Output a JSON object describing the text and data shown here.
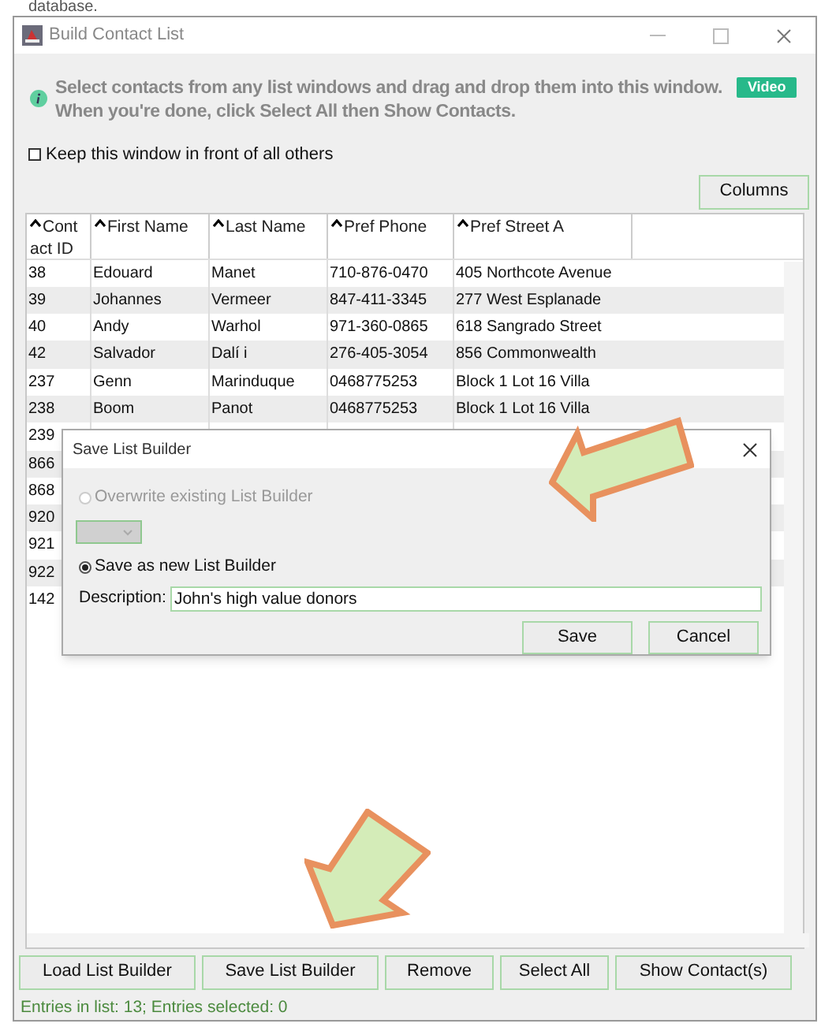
{
  "page_text": "database.",
  "window": {
    "title": "Build Contact List"
  },
  "info": {
    "lines": [
      "Select contacts from any list windows and drag and drop them into this window.",
      "When you're done, click Select All then Show Contacts."
    ],
    "video_button": "Video"
  },
  "keep_in_front": {
    "label": "Keep this window in front of all others",
    "checked": false
  },
  "columns_button": "Columns",
  "table": {
    "columns": [
      "Contact ID",
      "First Name",
      "Last Name",
      "Pref Phone",
      "Pref Street A"
    ],
    "rows": [
      [
        "38",
        "Edouard",
        "Manet",
        "710-876-0470",
        "405 Northcote Avenue"
      ],
      [
        "39",
        "Johannes",
        "Vermeer",
        "847-411-3345",
        "277 West Esplanade"
      ],
      [
        "40",
        "Andy",
        "Warhol",
        "971-360-0865",
        "618 Sangrado Street"
      ],
      [
        "42",
        "Salvador",
        "Dalí i",
        "276-405-3054",
        "856 Commonwealth"
      ],
      [
        "237",
        "Genn",
        "Marinduque",
        "0468775253",
        "Block 1 Lot 16 Villa"
      ],
      [
        "238",
        "Boom",
        "Panot",
        "0468775253",
        "Block 1 Lot 16 Villa"
      ],
      [
        "239"
      ],
      [
        "866"
      ],
      [
        "868"
      ],
      [
        "920"
      ],
      [
        "921"
      ],
      [
        "922"
      ],
      [
        "142"
      ]
    ]
  },
  "dialog": {
    "title": "Save List Builder",
    "options": [
      {
        "label": "Overwrite existing List Builder",
        "selected": false,
        "disabled": true
      },
      {
        "label": "Save as new List Builder",
        "selected": true,
        "disabled": false
      }
    ],
    "description_label": "Description:",
    "description_value": "John's high value donors",
    "buttons": [
      "Save",
      "Cancel"
    ]
  },
  "buttons": [
    "Load List Builder",
    "Save List Builder",
    "Remove",
    "Select All",
    "Show Contact(s)"
  ],
  "status_bar": "Entries in list: 13; Entries selected: 0"
}
